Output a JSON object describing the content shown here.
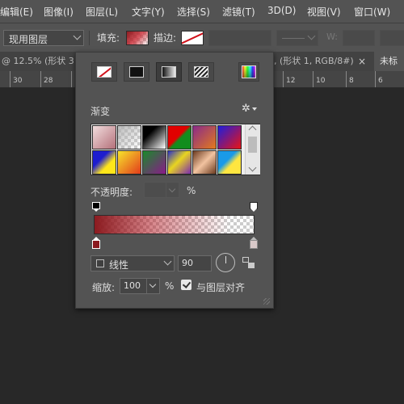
{
  "menubar": {
    "items": [
      {
        "label": "编辑(E)"
      },
      {
        "label": "图像(I)"
      },
      {
        "label": "图层(L)"
      },
      {
        "label": "文字(Y)"
      },
      {
        "label": "选择(S)"
      },
      {
        "label": "滤镜(T)"
      },
      {
        "label": "3D(D)"
      },
      {
        "label": "视图(V)"
      },
      {
        "label": "窗口(W)"
      }
    ]
  },
  "options_bar": {
    "layer_mode": "现用图层",
    "fill_label": "填充:",
    "stroke_label": "描边:",
    "width_label": "W:"
  },
  "tabs": {
    "left_tab": "@ 12.5% (形状 3",
    "right_tab": ", (形状 1, RGB/8#)",
    "close_glyph": "×",
    "untitled_tab": "未标"
  },
  "ruler": {
    "left_labels": [
      "30",
      "28"
    ],
    "right_labels": [
      "12",
      "10",
      "8",
      "6"
    ]
  },
  "popup": {
    "gradient_title": "渐变",
    "opacity_label": "不透明度:",
    "opacity_value": "",
    "opacity_unit": "%",
    "gradient_type": "线性",
    "angle_value": "90",
    "scale_label": "缩放:",
    "scale_value": "100",
    "scale_unit": "%",
    "align_label": "与图层对齐",
    "align_checked": true,
    "gear_glyph": "✲",
    "start_color": "#8b1a1f",
    "end_color": "#d9c9c9"
  }
}
